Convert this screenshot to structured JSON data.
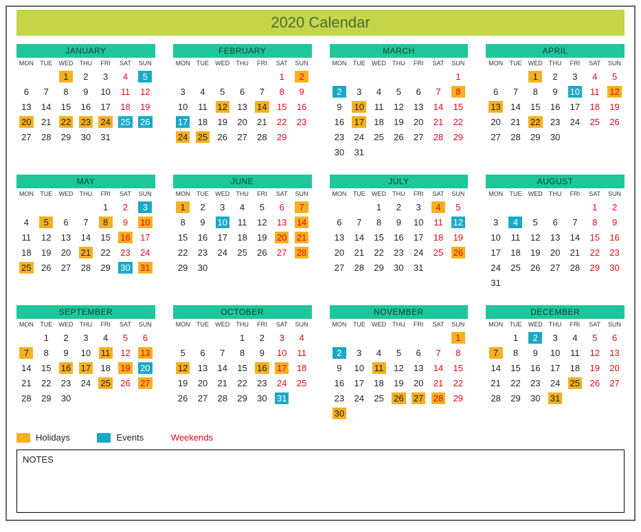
{
  "title": "2020 Calendar",
  "dow": [
    "MON",
    "TUE",
    "WED",
    "THU",
    "FRI",
    "SAT",
    "SUN"
  ],
  "months": [
    {
      "name": "JANUARY",
      "offset": 2,
      "days": 31,
      "holidays": [
        1,
        20,
        22,
        23,
        24
      ],
      "events": [
        5,
        25,
        26
      ]
    },
    {
      "name": "FEBRUARY",
      "offset": 5,
      "days": 29,
      "holidays": [
        2,
        12,
        14,
        24,
        25
      ],
      "events": [
        17
      ]
    },
    {
      "name": "MARCH",
      "offset": 6,
      "days": 31,
      "holidays": [
        8,
        10,
        17
      ],
      "events": [
        2
      ]
    },
    {
      "name": "APRIL",
      "offset": 2,
      "days": 30,
      "holidays": [
        1,
        12,
        13,
        22
      ],
      "events": [
        10
      ]
    },
    {
      "name": "MAY",
      "offset": 4,
      "days": 31,
      "holidays": [
        5,
        8,
        10,
        16,
        21,
        25,
        31
      ],
      "events": [
        3,
        30
      ]
    },
    {
      "name": "JUNE",
      "offset": 0,
      "days": 30,
      "holidays": [
        1,
        7,
        14,
        20,
        21,
        28
      ],
      "events": [
        10
      ]
    },
    {
      "name": "JULY",
      "offset": 2,
      "days": 31,
      "holidays": [
        4,
        26
      ],
      "events": [
        12
      ]
    },
    {
      "name": "AUGUST",
      "offset": 5,
      "days": 31,
      "holidays": [],
      "events": [
        4
      ]
    },
    {
      "name": "SEPTEMBER",
      "offset": 1,
      "days": 30,
      "holidays": [
        7,
        11,
        13,
        16,
        17,
        19,
        25,
        27
      ],
      "events": [
        20
      ]
    },
    {
      "name": "OCTOBER",
      "offset": 3,
      "days": 31,
      "holidays": [
        12,
        16,
        17
      ],
      "events": [
        31
      ]
    },
    {
      "name": "NOVEMBER",
      "offset": 6,
      "days": 30,
      "holidays": [
        1,
        11,
        26,
        27,
        28,
        30
      ],
      "events": [
        2
      ]
    },
    {
      "name": "DECEMBER",
      "offset": 1,
      "days": 31,
      "holidays": [
        7,
        25,
        31
      ],
      "events": [
        2
      ]
    }
  ],
  "legend": {
    "holidays": "Holidays",
    "events": "Events",
    "weekends": "Weekends"
  },
  "notes_label": "NOTES",
  "colors": {
    "holiday": "#f5b020",
    "event": "#1ba8c7",
    "weekend": "#e30613"
  }
}
